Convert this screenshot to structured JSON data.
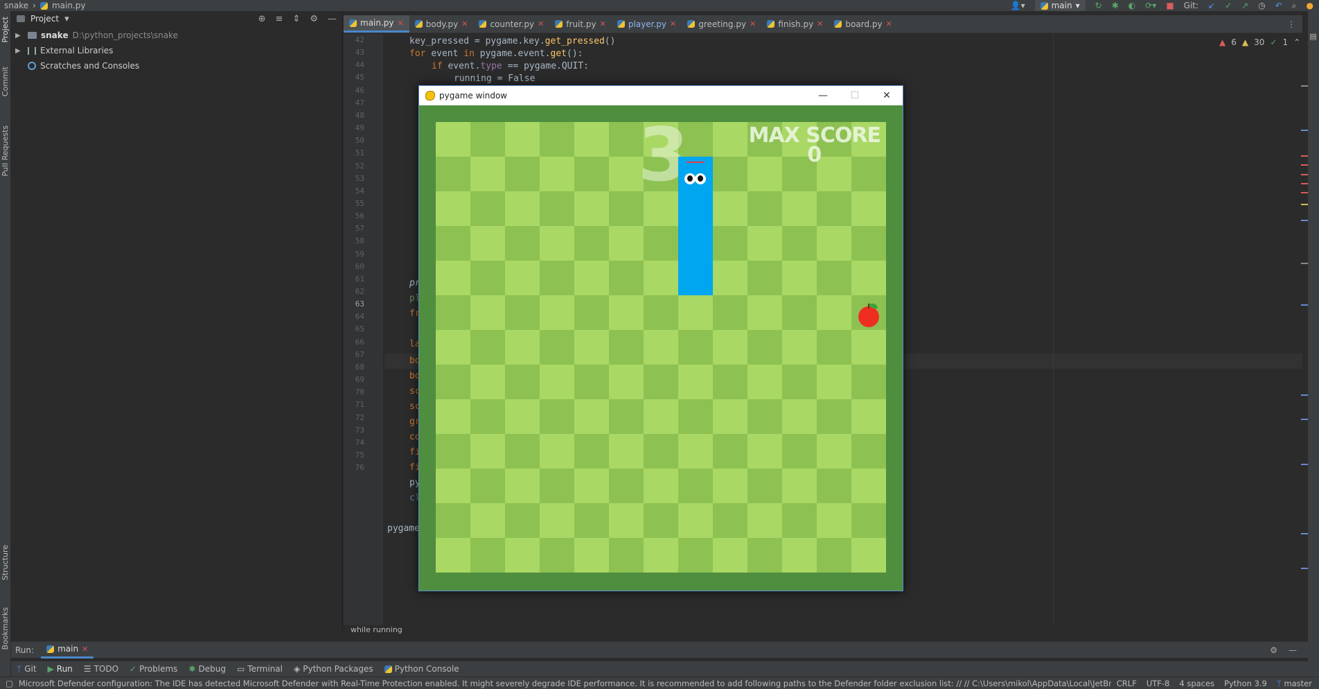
{
  "topbar": {
    "project_name": "snake",
    "file_name": "main.py",
    "branch": "main",
    "git_label": "Git:"
  },
  "project_panel": {
    "title": "Project",
    "tree": [
      {
        "label": "snake",
        "path": "D:\\python_projects\\snake"
      },
      {
        "label": "External Libraries"
      },
      {
        "label": "Scratches and Consoles"
      }
    ]
  },
  "left_strip": {
    "project": "Project",
    "commit": "Commit",
    "pull_requests": "Pull Requests",
    "structure": "Structure",
    "bookmarks": "Bookmarks"
  },
  "tabs": [
    {
      "label": "main.py",
      "active": true
    },
    {
      "label": "body.py"
    },
    {
      "label": "counter.py"
    },
    {
      "label": "fruit.py"
    },
    {
      "label": "player.py"
    },
    {
      "label": "greeting.py"
    },
    {
      "label": "finish.py"
    },
    {
      "label": "board.py"
    }
  ],
  "gutter": {
    "line_numbers": [
      "42",
      "43",
      "44",
      "45",
      "46",
      "47",
      "48",
      "49",
      "50",
      "51",
      "52",
      "53",
      "54",
      "55",
      "56",
      "57",
      "58",
      "59",
      "60",
      "61",
      "62",
      "63",
      "64",
      "65",
      "66",
      "67",
      "68",
      "69",
      "70",
      "71",
      "72",
      "73",
      "74",
      "75",
      "76"
    ],
    "current_line": "63"
  },
  "code": {
    "line42": {
      "a": "key_pressed = ",
      "b": "pygame.key.",
      "c": "get_pressed",
      "d": "()"
    },
    "line43": {
      "kw1": "for ",
      "a": "event ",
      "kw2": "in ",
      "b": "pygame.event.",
      "c": "get",
      "d": "():"
    },
    "line44": {
      "kw1": "if ",
      "a": "event.",
      "b": "type",
      "c": " == pygame.QUIT:"
    },
    "line45": "running = False",
    "line58": "pr",
    "line59": "pl",
    "line60": "fr",
    "line62": "la",
    "line63": "bo",
    "line64": "bo",
    "line65": "sc",
    "line66": "sc",
    "line67": "gr",
    "line68": "co",
    "line69": "fi",
    "line70": "fi",
    "line71": "py",
    "line72": "cl",
    "line74": "pygame"
  },
  "inspections": {
    "errors": "6",
    "warnings": "30",
    "ok": "1"
  },
  "editor_hint": "while running",
  "run_bar": {
    "label": "Run:",
    "tab": "main"
  },
  "tool_windows": [
    "Git",
    "Run",
    "TODO",
    "Problems",
    "Debug",
    "Terminal",
    "Python Packages",
    "Python Console"
  ],
  "status_bar": {
    "message": "Microsoft Defender configuration: The IDE has detected Microsoft Defender with Real-Time Protection enabled. It might severely degrade IDE performance. It is recommended to add following paths to the Defender folder exclusion list: // //  C:\\Users\\mikol\\AppData\\Local\\JetBr... (moments ago)",
    "line_sep": "CRLF",
    "encoding": "UTF-8",
    "indent": "4 spaces",
    "interpreter": "Python 3.9",
    "branch": "master"
  },
  "pygame": {
    "window_title": "pygame window",
    "countdown": "3",
    "max_score_label": "MAX SCORE",
    "max_score_value": "0",
    "colors": {
      "snake": "#00a6ef",
      "apple": "#ef2e22",
      "grass_light": "#a9d865",
      "grass_dark": "#8dc152",
      "border": "#4e8e3e"
    }
  }
}
